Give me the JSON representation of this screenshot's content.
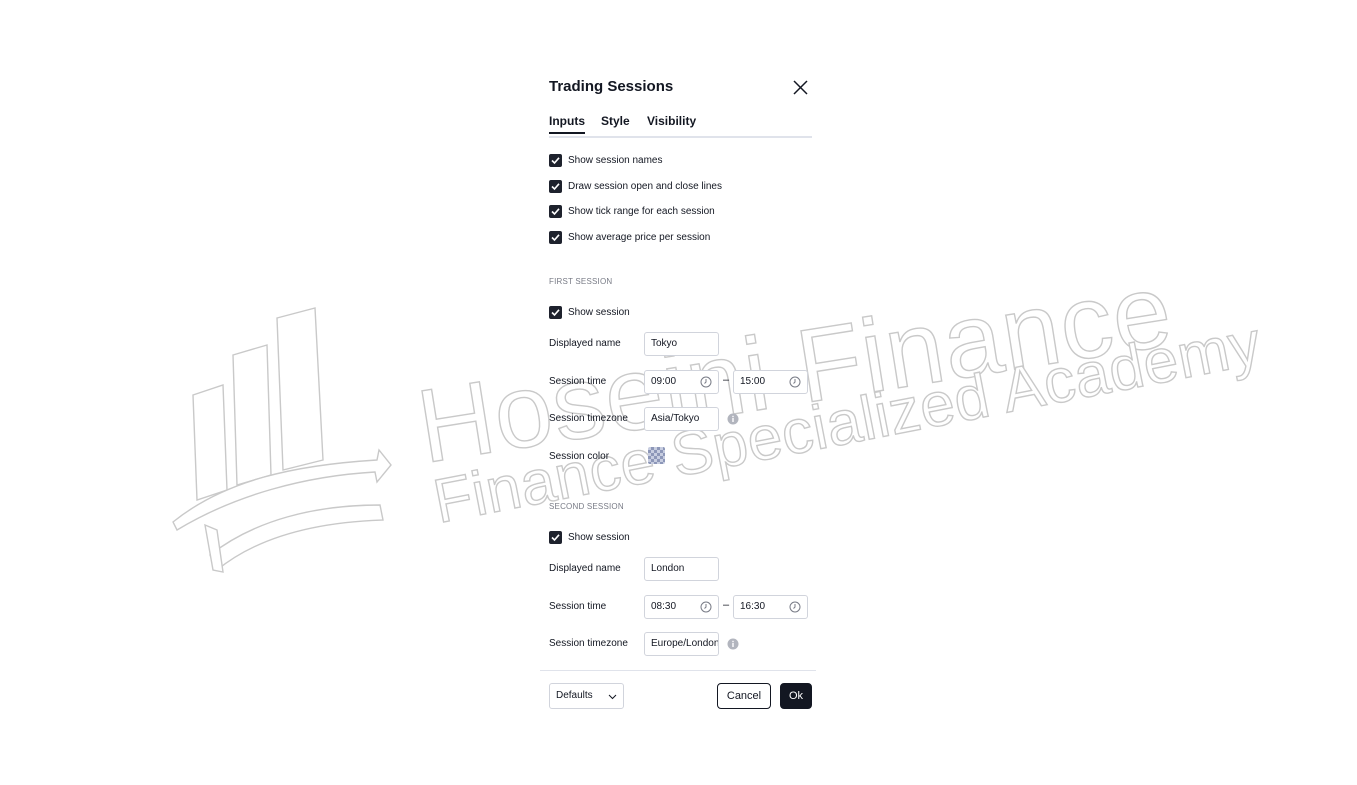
{
  "dialog": {
    "title": "Trading Sessions",
    "close_icon": "close-icon"
  },
  "tabs": [
    {
      "label": "Inputs",
      "active": true
    },
    {
      "label": "Style",
      "active": false
    },
    {
      "label": "Visibility",
      "active": false
    }
  ],
  "options": [
    {
      "label": "Show session names",
      "checked": true
    },
    {
      "label": "Draw session open and close lines",
      "checked": true
    },
    {
      "label": "Show tick range for each session",
      "checked": true
    },
    {
      "label": "Show average price per session",
      "checked": true
    }
  ],
  "first_session": {
    "section_label": "FIRST SESSION",
    "show_label": "Show session",
    "show_checked": true,
    "name_label": "Displayed name",
    "name_value": "Tokyo",
    "time_label": "Session time",
    "start": "09:00",
    "end": "15:00",
    "separator": "–",
    "timezone_label": "Session timezone",
    "timezone_value": "Asia/Tokyo",
    "color_label": "Session color"
  },
  "second_session": {
    "section_label": "SECOND SESSION",
    "show_label": "Show session",
    "show_checked": true,
    "name_label": "Displayed name",
    "name_value": "London",
    "time_label": "Session time",
    "start": "08:30",
    "end": "16:30",
    "separator": "–",
    "timezone_label": "Session timezone",
    "timezone_value": "Europe/London"
  },
  "footer": {
    "defaults_label": "Defaults",
    "cancel_label": "Cancel",
    "ok_label": "Ok"
  },
  "watermark": {
    "line1": "Hoseini Finance",
    "line2": "Finance Specialized Academy"
  },
  "colors": {
    "text": "#131722",
    "checkbox": "#1e222d",
    "border": "#d1d4dc",
    "muted": "#787b86"
  }
}
